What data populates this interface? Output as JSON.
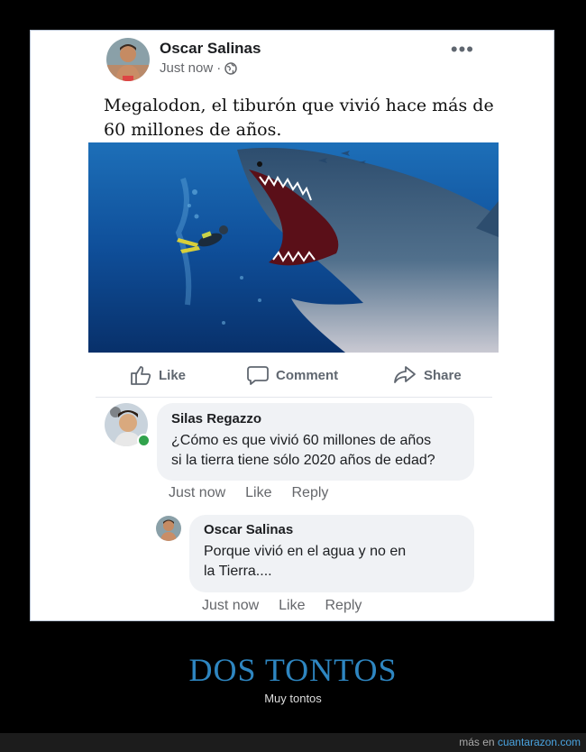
{
  "post": {
    "author": "Oscar Salinas",
    "time": "Just now",
    "privacy_icon": "globe-icon",
    "more_label": "•••",
    "text": "Megalodon, el tiburón que vivió hace más de 60 millones de años."
  },
  "actions": {
    "like": "Like",
    "comment": "Comment",
    "share": "Share"
  },
  "comments": [
    {
      "author": "Silas Regazzo",
      "text_line1": "¿Cómo es que vivió 60 millones de años",
      "text_line2": "si la tierra tiene sólo 2020 años de edad?",
      "time": "Just now",
      "like": "Like",
      "reply": "Reply"
    },
    {
      "author": "Oscar Salinas",
      "text_line1": "Porque vivió en el agua y no en",
      "text_line2": "la Tierra....",
      "time": "Just now",
      "like": "Like",
      "reply": "Reply"
    }
  ],
  "caption": {
    "title": "DOS TONTOS",
    "subtitle": "Muy tontos"
  },
  "footer": {
    "prefix": "más en",
    "site": "cuantarazon.com"
  },
  "colors": {
    "caption_title": "#2e86c1",
    "link_text": "#65676b",
    "online": "#31a24c"
  }
}
